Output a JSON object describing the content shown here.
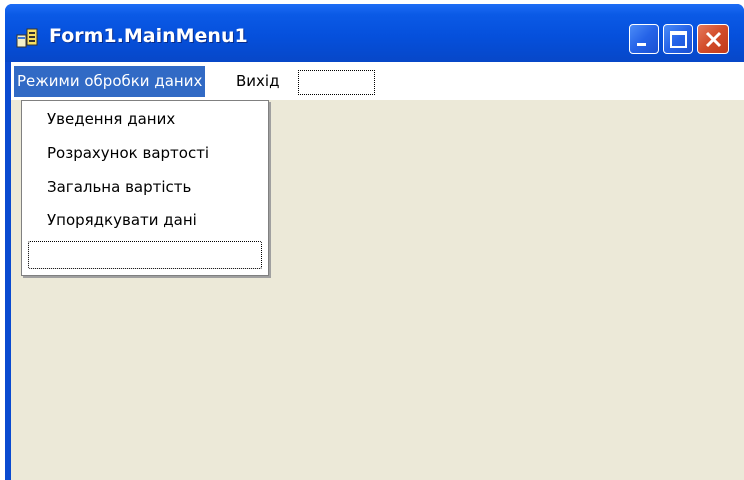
{
  "window": {
    "title": "Form1.MainMenu1",
    "app_icon": "form-app-icon",
    "controls": {
      "minimize_icon": "minimize-icon",
      "maximize_icon": "maximize-icon",
      "close_icon": "close-icon"
    }
  },
  "menubar": {
    "items": [
      {
        "label": "Режими обробки даних",
        "state": "selected"
      },
      {
        "label": "Вихід"
      }
    ]
  },
  "dropdown": {
    "items": [
      {
        "label": "Уведення даних"
      },
      {
        "label": "Розрахунок вартості"
      },
      {
        "label": "Загальна вартість"
      },
      {
        "label": "Упорядкувати дані"
      }
    ]
  },
  "colors": {
    "titlebar": "#0550dc",
    "selection": "#316ac5",
    "client_bg": "#ece9d8",
    "close_button": "#d24c2a"
  }
}
